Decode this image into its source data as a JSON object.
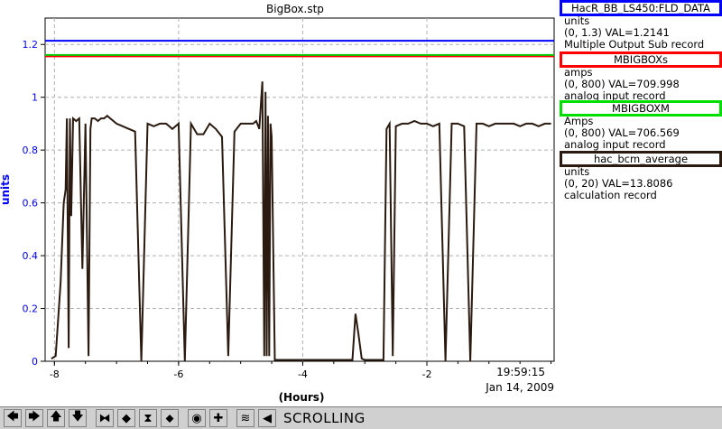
{
  "chart_data": {
    "type": "line",
    "title": "BigBox.stp",
    "xlabel": "(Hours)",
    "ylabel": "units",
    "xlim": [
      -8.15,
      0.05
    ],
    "ylim": [
      0,
      1.3
    ],
    "x_ticks": [
      -8,
      -6,
      -4,
      -2
    ],
    "y_ticks": [
      0,
      0.2,
      0.4,
      0.6,
      0.8,
      1,
      1.2
    ],
    "x_tick_labels": [
      "-8",
      "-6",
      "-4",
      "-2"
    ],
    "y_tick_labels": [
      "0",
      "0.2",
      "0.4",
      "0.6",
      "0.8",
      "1",
      "1.2"
    ],
    "time_label": "19:59:15",
    "date_label": "Jan 14, 2009",
    "grid": true,
    "series": [
      {
        "name": "HacR_BB_LS450:FLD_DATA",
        "color": "#0000ff",
        "style": "constant",
        "value": 1.2141
      },
      {
        "name": "MBIGBOXs",
        "color": "#ff0000",
        "style": "constant",
        "value": 1.155
      },
      {
        "name": "MBIGBOXM",
        "color": "#00cc00",
        "style": "constant",
        "value": 1.16
      },
      {
        "name": "hac_bcm_average",
        "color": "#2a1a10",
        "style": "trace",
        "x": [
          -8.05,
          -7.98,
          -7.9,
          -7.85,
          -7.82,
          -7.8,
          -7.77,
          -7.75,
          -7.73,
          -7.7,
          -7.65,
          -7.6,
          -7.55,
          -7.5,
          -7.45,
          -7.42,
          -7.4,
          -7.35,
          -7.3,
          -7.25,
          -7.2,
          -7.15,
          -7.1,
          -7.0,
          -6.9,
          -6.8,
          -6.7,
          -6.6,
          -6.5,
          -6.4,
          -6.3,
          -6.2,
          -6.1,
          -6.0,
          -5.9,
          -5.8,
          -5.7,
          -5.6,
          -5.5,
          -5.4,
          -5.3,
          -5.2,
          -5.1,
          -5.0,
          -4.9,
          -4.8,
          -4.75,
          -4.7,
          -4.65,
          -4.62,
          -4.6,
          -4.58,
          -4.56,
          -4.54,
          -4.52,
          -4.5,
          -4.45,
          -4.4,
          -3.6,
          -3.2,
          -3.15,
          -3.1,
          -3.05,
          -3.0,
          -2.7,
          -2.65,
          -2.6,
          -2.55,
          -2.5,
          -2.4,
          -2.3,
          -2.2,
          -2.1,
          -2.0,
          -1.9,
          -1.8,
          -1.7,
          -1.6,
          -1.5,
          -1.4,
          -1.3,
          -1.2,
          -1.1,
          -1.0,
          -0.9,
          -0.8,
          -0.7,
          -0.6,
          -0.5,
          -0.4,
          -0.3,
          -0.2,
          -0.1,
          0.0
        ],
        "y": [
          0.01,
          0.02,
          0.3,
          0.6,
          0.65,
          0.92,
          0.05,
          0.92,
          0.55,
          0.92,
          0.91,
          0.92,
          0.35,
          0.9,
          0.02,
          0.88,
          0.92,
          0.92,
          0.91,
          0.92,
          0.92,
          0.93,
          0.92,
          0.9,
          0.89,
          0.88,
          0.87,
          0.0,
          0.9,
          0.89,
          0.9,
          0.9,
          0.88,
          0.9,
          0.0,
          0.9,
          0.86,
          0.86,
          0.9,
          0.88,
          0.85,
          0.02,
          0.87,
          0.9,
          0.9,
          0.9,
          0.91,
          0.88,
          1.06,
          0.02,
          1.02,
          0.02,
          0.93,
          0.02,
          0.9,
          0.85,
          0.005,
          0.005,
          0.005,
          0.005,
          0.18,
          0.1,
          0.01,
          0.005,
          0.005,
          0.88,
          0.9,
          0.02,
          0.89,
          0.9,
          0.9,
          0.91,
          0.9,
          0.9,
          0.89,
          0.9,
          0.0,
          0.9,
          0.9,
          0.89,
          0.0,
          0.9,
          0.9,
          0.89,
          0.9,
          0.9,
          0.9,
          0.9,
          0.89,
          0.9,
          0.9,
          0.89,
          0.9,
          0.9
        ]
      }
    ]
  },
  "legend": [
    {
      "name": "HacR_BB_LS450:FLD_DATA",
      "color": "#0000ff",
      "units": "units",
      "range_val": "(0, 1.3) VAL=1.2141",
      "rec_type": "Multiple Output Sub record"
    },
    {
      "name": "MBIGBOXs",
      "color": "#ff0000",
      "units": "amps",
      "range_val": "(0, 800) VAL=709.998",
      "rec_type": "analog input record"
    },
    {
      "name": "MBIGBOXM",
      "color": "#00dd00",
      "units": "Amps",
      "range_val": "(0, 800) VAL=706.569",
      "rec_type": "analog input record"
    },
    {
      "name": "hac_bcm_average",
      "color": "#2a1a10",
      "units": "units",
      "range_val": "(0, 20) VAL=13.8086",
      "rec_type": "calculation record"
    }
  ],
  "toolbar": {
    "buttons": [
      {
        "name": "left-arrow-icon",
        "glyph": "🡄"
      },
      {
        "name": "right-arrow-icon",
        "glyph": "🡆"
      },
      {
        "name": "up-arrow-icon",
        "glyph": "🡅"
      },
      {
        "name": "down-arrow-icon",
        "glyph": "🡇"
      },
      {
        "name": "zoom-in-horizontal-icon",
        "glyph": "⧓"
      },
      {
        "name": "zoom-out-horizontal-icon",
        "glyph": "◆"
      },
      {
        "name": "zoom-in-vertical-icon",
        "glyph": "⧗"
      },
      {
        "name": "zoom-out-vertical-icon",
        "glyph": "⬥"
      },
      {
        "name": "reset-icon",
        "glyph": "◉"
      },
      {
        "name": "add-icon",
        "glyph": "✚"
      },
      {
        "name": "style-icon",
        "glyph": "≋"
      },
      {
        "name": "back-to-now-icon",
        "glyph": "◀"
      }
    ],
    "status": "SCROLLING"
  }
}
